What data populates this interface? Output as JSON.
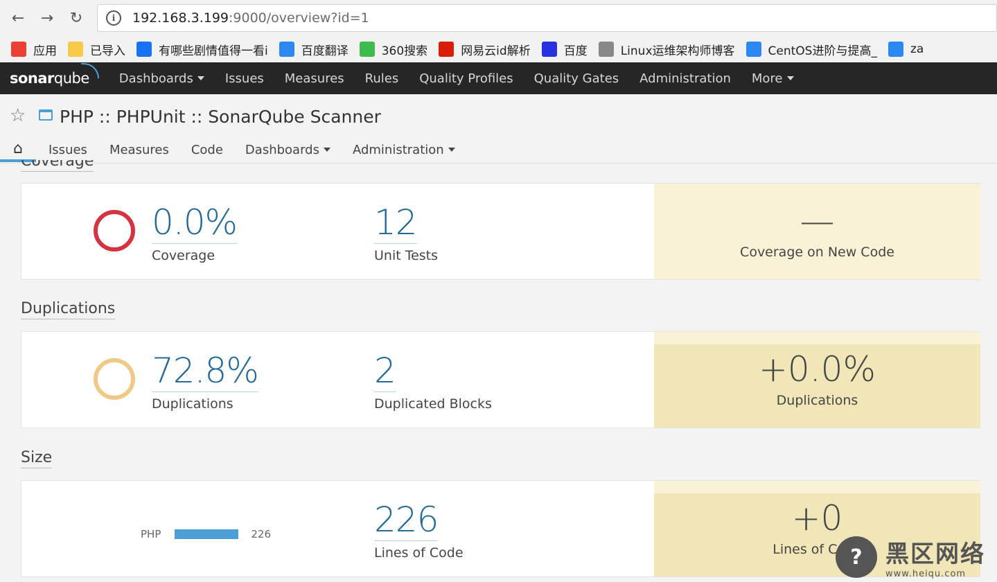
{
  "browser": {
    "url_host": "192.168.3.199",
    "url_rest": ":9000/overview?id=1",
    "bookmarks": [
      {
        "label": "应用",
        "icon": "apps-grid-icon",
        "color": "#e94235"
      },
      {
        "label": "已导入",
        "icon": "folder-icon",
        "color": "#f7c948"
      },
      {
        "label": "有哪些剧情值得一看i",
        "icon": "zhihu-icon",
        "color": "#1772f6"
      },
      {
        "label": "百度翻译",
        "icon": "translate-icon",
        "color": "#2b88f0"
      },
      {
        "label": "360搜索",
        "icon": "search-360-icon",
        "color": "#3dbb4d"
      },
      {
        "label": "网易云id解析",
        "icon": "netease-icon",
        "color": "#d81e06"
      },
      {
        "label": "百度",
        "icon": "baidu-paw-icon",
        "color": "#2932e1"
      },
      {
        "label": "Linux运维架构师博客",
        "icon": "page-icon",
        "color": "#888888"
      },
      {
        "label": "CentOS进阶与提高_",
        "icon": "centos-icon",
        "color": "#2b88f0"
      },
      {
        "label": "za",
        "icon": "za-icon",
        "color": "#2b88f0"
      }
    ]
  },
  "sonar": {
    "logo_text_bold": "sonar",
    "logo_text_light": "qube",
    "nav": [
      {
        "label": "Dashboards",
        "caret": true
      },
      {
        "label": "Issues",
        "caret": false
      },
      {
        "label": "Measures",
        "caret": false
      },
      {
        "label": "Rules",
        "caret": false
      },
      {
        "label": "Quality Profiles",
        "caret": false
      },
      {
        "label": "Quality Gates",
        "caret": false
      },
      {
        "label": "Administration",
        "caret": false
      },
      {
        "label": "More",
        "caret": true
      }
    ]
  },
  "project": {
    "title": "PHP :: PHPUnit :: SonarQube Scanner",
    "tabs": [
      {
        "label": "Issues",
        "caret": false
      },
      {
        "label": "Measures",
        "caret": false
      },
      {
        "label": "Code",
        "caret": false
      },
      {
        "label": "Dashboards",
        "caret": true
      },
      {
        "label": "Administration",
        "caret": true
      }
    ]
  },
  "coverage": {
    "title": "Coverage",
    "coverage_value": "0.0%",
    "coverage_label": "Coverage",
    "unit_tests_value": "12",
    "unit_tests_label": "Unit Tests",
    "new_value": "—",
    "new_label": "Coverage on New Code",
    "donut_color": "#d4333f"
  },
  "duplications": {
    "title": "Duplications",
    "dup_value": "72.8%",
    "dup_label": "Duplications",
    "blocks_value": "2",
    "blocks_label": "Duplicated Blocks",
    "new_value": "+0.0%",
    "new_label": "Duplications",
    "donut_color": "#f0c987"
  },
  "size": {
    "title": "Size",
    "lang_name": "PHP",
    "lang_value": "226",
    "loc_value": "226",
    "loc_label": "Lines of Code",
    "new_value": "+0",
    "new_label": "Lines of Code"
  },
  "watermark": {
    "big": "黑区网络",
    "small": "www.heiqu.com"
  }
}
